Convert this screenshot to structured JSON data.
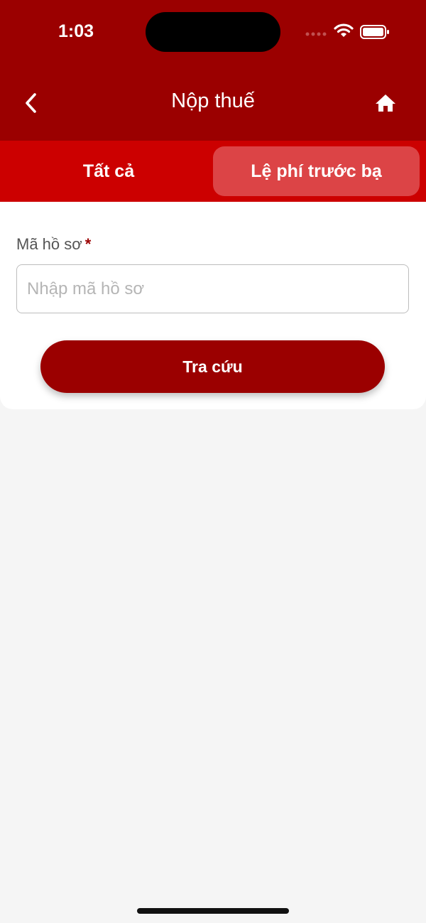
{
  "status_bar": {
    "time": "1:03"
  },
  "nav": {
    "title": "Nộp thuế"
  },
  "tabs": [
    {
      "label": "Tất cả",
      "selected": false
    },
    {
      "label": "Lệ phí trước bạ",
      "selected": true
    }
  ],
  "form": {
    "field_label": "Mã hồ sơ",
    "required_mark": "*",
    "input_value": "",
    "input_placeholder": "Nhập mã hồ sơ",
    "submit_label": "Tra cứu"
  },
  "colors": {
    "header": "#9b0000",
    "tabbar": "#cc0000",
    "active_tab": "#dc4446",
    "button": "#9b0000"
  },
  "icons": [
    "chevron-left-icon",
    "home-icon",
    "cellular-signal-icon",
    "wifi-icon",
    "battery-icon"
  ]
}
